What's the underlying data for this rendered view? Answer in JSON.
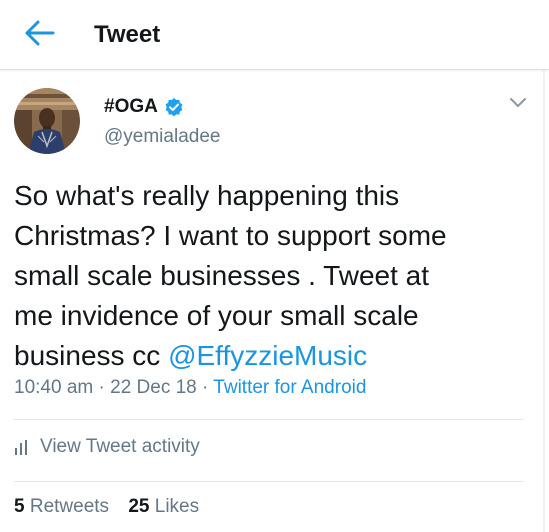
{
  "header": {
    "title": "Tweet",
    "back_icon": "arrow-left-icon"
  },
  "tweet": {
    "author": {
      "display_name": "#OGA",
      "handle": "@yemialadee",
      "verified_icon": "verified-badge-icon"
    },
    "text_before_mention": "So what's really happening this\nChristmas? I want to support some\nsmall scale businesses . Tweet at\nme invidence of your small scale\nbusiness cc ",
    "mention": "@EffyzzieMusic",
    "time": "10:40 am",
    "date": "22 Dec 18",
    "separator": "·",
    "client": "Twitter for Android",
    "activity_label": "View Tweet activity",
    "retweets_count": "5",
    "retweets_label": "Retweets",
    "likes_count": "25",
    "likes_label": "Likes"
  },
  "colors": {
    "accent": "#1b95e0",
    "secondary_text": "#657786",
    "primary_text": "#14171a",
    "divider": "#e1e8ed"
  }
}
